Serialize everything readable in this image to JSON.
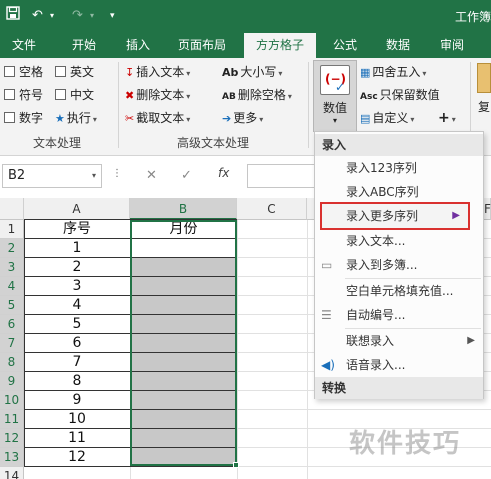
{
  "window": {
    "title": "工作簿"
  },
  "quick_access": {
    "save_icon": "save-icon",
    "undo_icon": "undo-icon",
    "redo_icon": "redo-icon"
  },
  "tabs": [
    "文件",
    "开始",
    "插入",
    "页面布局",
    "方方格子",
    "公式",
    "数据",
    "审阅"
  ],
  "active_tab": "方方格子",
  "ribbon": {
    "text_processing": {
      "items": [
        "空格",
        "英文",
        "符号",
        "中文",
        "数字",
        "执行"
      ],
      "group_label": "文本处理"
    },
    "advanced_text": {
      "items": [
        "插入文本",
        "删除文本",
        "截取文本",
        "大小写",
        "删除空格",
        "更多"
      ],
      "group_label": "高级文本处理"
    },
    "numeric": {
      "button_label": "数值",
      "items": [
        "四舍五入",
        "只保留数值",
        "自定义"
      ],
      "plus_label": "+"
    },
    "right_partial": "复"
  },
  "formula_bar": {
    "name_box": "B2",
    "cancel_label": "✕",
    "confirm_label": "✓",
    "fx_label": "fx"
  },
  "sheet": {
    "columns": [
      "A",
      "B",
      "C"
    ],
    "rows": [
      "1",
      "2",
      "3",
      "4",
      "5",
      "6",
      "7",
      "8",
      "9",
      "10",
      "11",
      "12",
      "13",
      "14"
    ],
    "headers": {
      "a": "序号",
      "b": "月份"
    },
    "a_values": [
      "1",
      "2",
      "3",
      "4",
      "5",
      "6",
      "7",
      "8",
      "9",
      "10",
      "11",
      "12"
    ],
    "selected_column": "B",
    "selected_cell": "B2"
  },
  "menu": {
    "section_input": "录入",
    "items": [
      "录入123序列",
      "录入ABC序列",
      "录入更多序列",
      "录入文本...",
      "录入到多簿...",
      "空白单元格填充值...",
      "自动编号...",
      "联想录入",
      "语音录入..."
    ],
    "highlighted": "录入更多序列",
    "section_convert": "转换",
    "peek_label": "F"
  },
  "watermark": "软件技巧",
  "colors": {
    "excel_green": "#217346",
    "highlight_red": "#d9312f",
    "selection_gray": "#c8c8c8"
  }
}
